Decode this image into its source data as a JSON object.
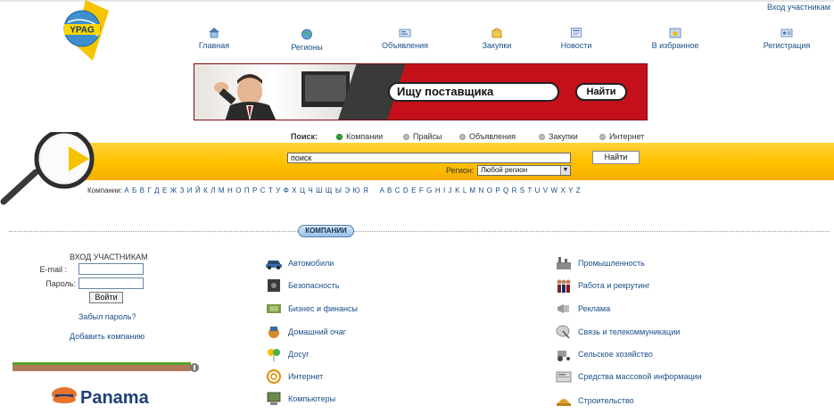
{
  "header": {
    "login_link": "Вход участникам",
    "logo_text": "YPAG"
  },
  "nav": {
    "items": [
      {
        "label": "Главная",
        "icon": "home-icon"
      },
      {
        "label": "Регионы",
        "icon": "globe-icon"
      },
      {
        "label": "Объявления",
        "icon": "ads-icon"
      },
      {
        "label": "Закупки",
        "icon": "purchases-icon"
      },
      {
        "label": "Новости",
        "icon": "news-icon"
      },
      {
        "label": "В избранное",
        "icon": "favorites-icon"
      },
      {
        "label": "Регистрация",
        "icon": "registration-icon"
      }
    ]
  },
  "banner": {
    "search_text": "Ищу поставщика",
    "button_label": "Найти"
  },
  "search": {
    "label": "Поиск:",
    "tabs": [
      {
        "label": "Компании",
        "selected": true
      },
      {
        "label": "Прайсы",
        "selected": false
      },
      {
        "label": "Объявления",
        "selected": false
      },
      {
        "label": "Закупки",
        "selected": false
      },
      {
        "label": "Интернет",
        "selected": false
      }
    ],
    "input_value": "поиск",
    "button_label": "Найти",
    "region_label": "Регион:",
    "region_value": "Любой регион"
  },
  "alphabet": {
    "label": "Компании:",
    "ru": "А Б В Г Д Е Ж З И Й К Л М Н О П Р С Т У Ф Х Ц Ч Ш Щ Ы Э Ю Я",
    "en": "A B C D E F G H I J K L M N O P Q R S T U V W X Y Z"
  },
  "section": {
    "title": "КОМПАНИИ"
  },
  "login": {
    "title": "ВХОД УЧАСТНИКАМ",
    "email_label": "E-mail :",
    "password_label": "Пароль:",
    "button_label": "Войти",
    "forgot_label": "Забыл пароль?",
    "add_company_label": "Добавить компанию"
  },
  "ad": {
    "brand": "Panama"
  },
  "categories": {
    "left": [
      {
        "label": "Автомобили",
        "icon": "car-icon"
      },
      {
        "label": "Безопасность",
        "icon": "safe-icon"
      },
      {
        "label": "Бизнес и финансы",
        "icon": "money-icon"
      },
      {
        "label": "Домашний очаг",
        "icon": "home-hearth-icon"
      },
      {
        "label": "Досуг",
        "icon": "balloons-icon"
      },
      {
        "label": "Интернет",
        "icon": "at-sign-icon"
      },
      {
        "label": "Компьютеры",
        "icon": "computer-icon"
      }
    ],
    "right": [
      {
        "label": "Промышленность",
        "icon": "factory-icon"
      },
      {
        "label": "Работа и рекрутинг",
        "icon": "people-icon"
      },
      {
        "label": "Реклама",
        "icon": "megaphone-icon"
      },
      {
        "label": "Связь и телекоммуникации",
        "icon": "satellite-icon"
      },
      {
        "label": "Сельское хозяйство",
        "icon": "tractor-icon"
      },
      {
        "label": "Средства массовой информации",
        "icon": "media-icon"
      },
      {
        "label": "Строительство",
        "icon": "construction-icon"
      }
    ]
  },
  "colors": {
    "link": "#1a4f8a",
    "bar_yellow": "#ffc200",
    "banner_red": "#c4101a"
  }
}
